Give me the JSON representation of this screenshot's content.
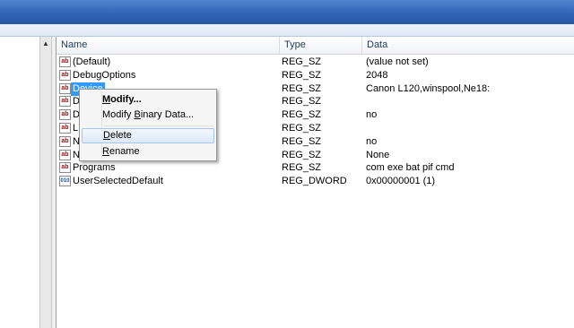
{
  "columns": {
    "name": "Name",
    "type": "Type",
    "data": "Data"
  },
  "rows": [
    {
      "name": "(Default)",
      "type": "REG_SZ",
      "data": "(value not set)",
      "icon": "string-value-icon"
    },
    {
      "name": "DebugOptions",
      "type": "REG_SZ",
      "data": "2048",
      "icon": "string-value-icon"
    },
    {
      "name": "Device",
      "type": "REG_SZ",
      "data": "Canon L120,winspool,Ne18:",
      "icon": "string-value-icon",
      "selected": true
    },
    {
      "name": "D",
      "type": "REG_SZ",
      "data": "",
      "icon": "string-value-icon"
    },
    {
      "name": "D",
      "type": "REG_SZ",
      "data": "no",
      "icon": "string-value-icon"
    },
    {
      "name": "L",
      "type": "REG_SZ",
      "data": "",
      "icon": "string-value-icon"
    },
    {
      "name": "N",
      "type": "REG_SZ",
      "data": "no",
      "icon": "string-value-icon"
    },
    {
      "name": "N",
      "type": "REG_SZ",
      "data": "None",
      "icon": "string-value-icon"
    },
    {
      "name": "Programs",
      "type": "REG_SZ",
      "data": "com exe bat pif cmd",
      "icon": "string-value-icon"
    },
    {
      "name": "UserSelectedDefault",
      "type": "REG_DWORD",
      "data": "0x00000001 (1)",
      "icon": "dword-value-icon"
    }
  ],
  "icon_glyphs": {
    "string": "ab",
    "dword": "010"
  },
  "context_menu": {
    "modify": {
      "accel": "M",
      "rest": "odify..."
    },
    "modify_binary": {
      "pre": "Modify ",
      "accel": "B",
      "rest": "inary Data..."
    },
    "delete": {
      "accel": "D",
      "rest": "elete"
    },
    "rename": {
      "accel": "R",
      "rest": "ename"
    }
  },
  "scroll_up_glyph": "▲",
  "colors": {
    "selection": "#3399ff",
    "titlebar": "#2f65b5",
    "menu_hover_border": "#a8c6ea"
  }
}
